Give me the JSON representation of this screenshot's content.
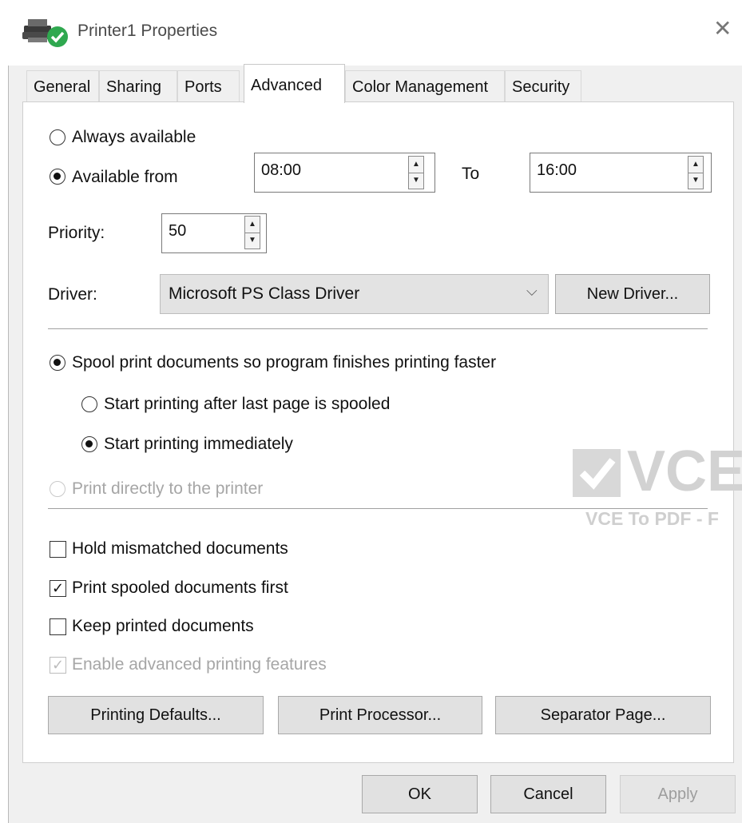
{
  "window": {
    "title": "Printer1 Properties",
    "close_glyph": "✕",
    "icon": "printer-check-icon"
  },
  "tabs": [
    {
      "label": "General"
    },
    {
      "label": "Sharing"
    },
    {
      "label": "Ports"
    },
    {
      "label": "Advanced",
      "active": true
    },
    {
      "label": "Color Management"
    },
    {
      "label": "Security"
    }
  ],
  "availability": {
    "always_label": "Always available",
    "from_label": "Available from",
    "from_value": "08:00",
    "to_label": "To",
    "to_value": "16:00",
    "selected": "from"
  },
  "priority": {
    "label": "Priority:",
    "value": "50"
  },
  "driver": {
    "label": "Driver:",
    "value": "Microsoft PS Class Driver",
    "new_button": "New Driver..."
  },
  "spool": {
    "spool_label": "Spool print documents so program finishes printing faster",
    "after_last_label": "Start printing after last page is spooled",
    "immediately_label": "Start printing immediately",
    "direct_label": "Print directly to the printer"
  },
  "options": {
    "hold_label": "Hold mismatched documents",
    "hold_checked": false,
    "spooled_first_label": "Print spooled documents first",
    "spooled_first_checked": true,
    "keep_label": "Keep printed documents",
    "keep_checked": false,
    "advanced_label": "Enable advanced printing features",
    "advanced_checked": true,
    "check_glyph": "✓"
  },
  "buttons": {
    "printing_defaults": "Printing Defaults...",
    "print_processor": "Print Processor...",
    "separator_page": "Separator Page...",
    "ok": "OK",
    "cancel": "Cancel",
    "apply": "Apply"
  },
  "spin_glyphs": {
    "up": "▲",
    "down": "▼",
    "dropdown": "⌵"
  },
  "watermark": {
    "logo_text": "VCE",
    "caption": "VCE To PDF - F"
  },
  "colors": {
    "accent_check": "#2fa84f",
    "button_face": "#e1e1e1",
    "disabled_text": "#a6a6a6"
  }
}
